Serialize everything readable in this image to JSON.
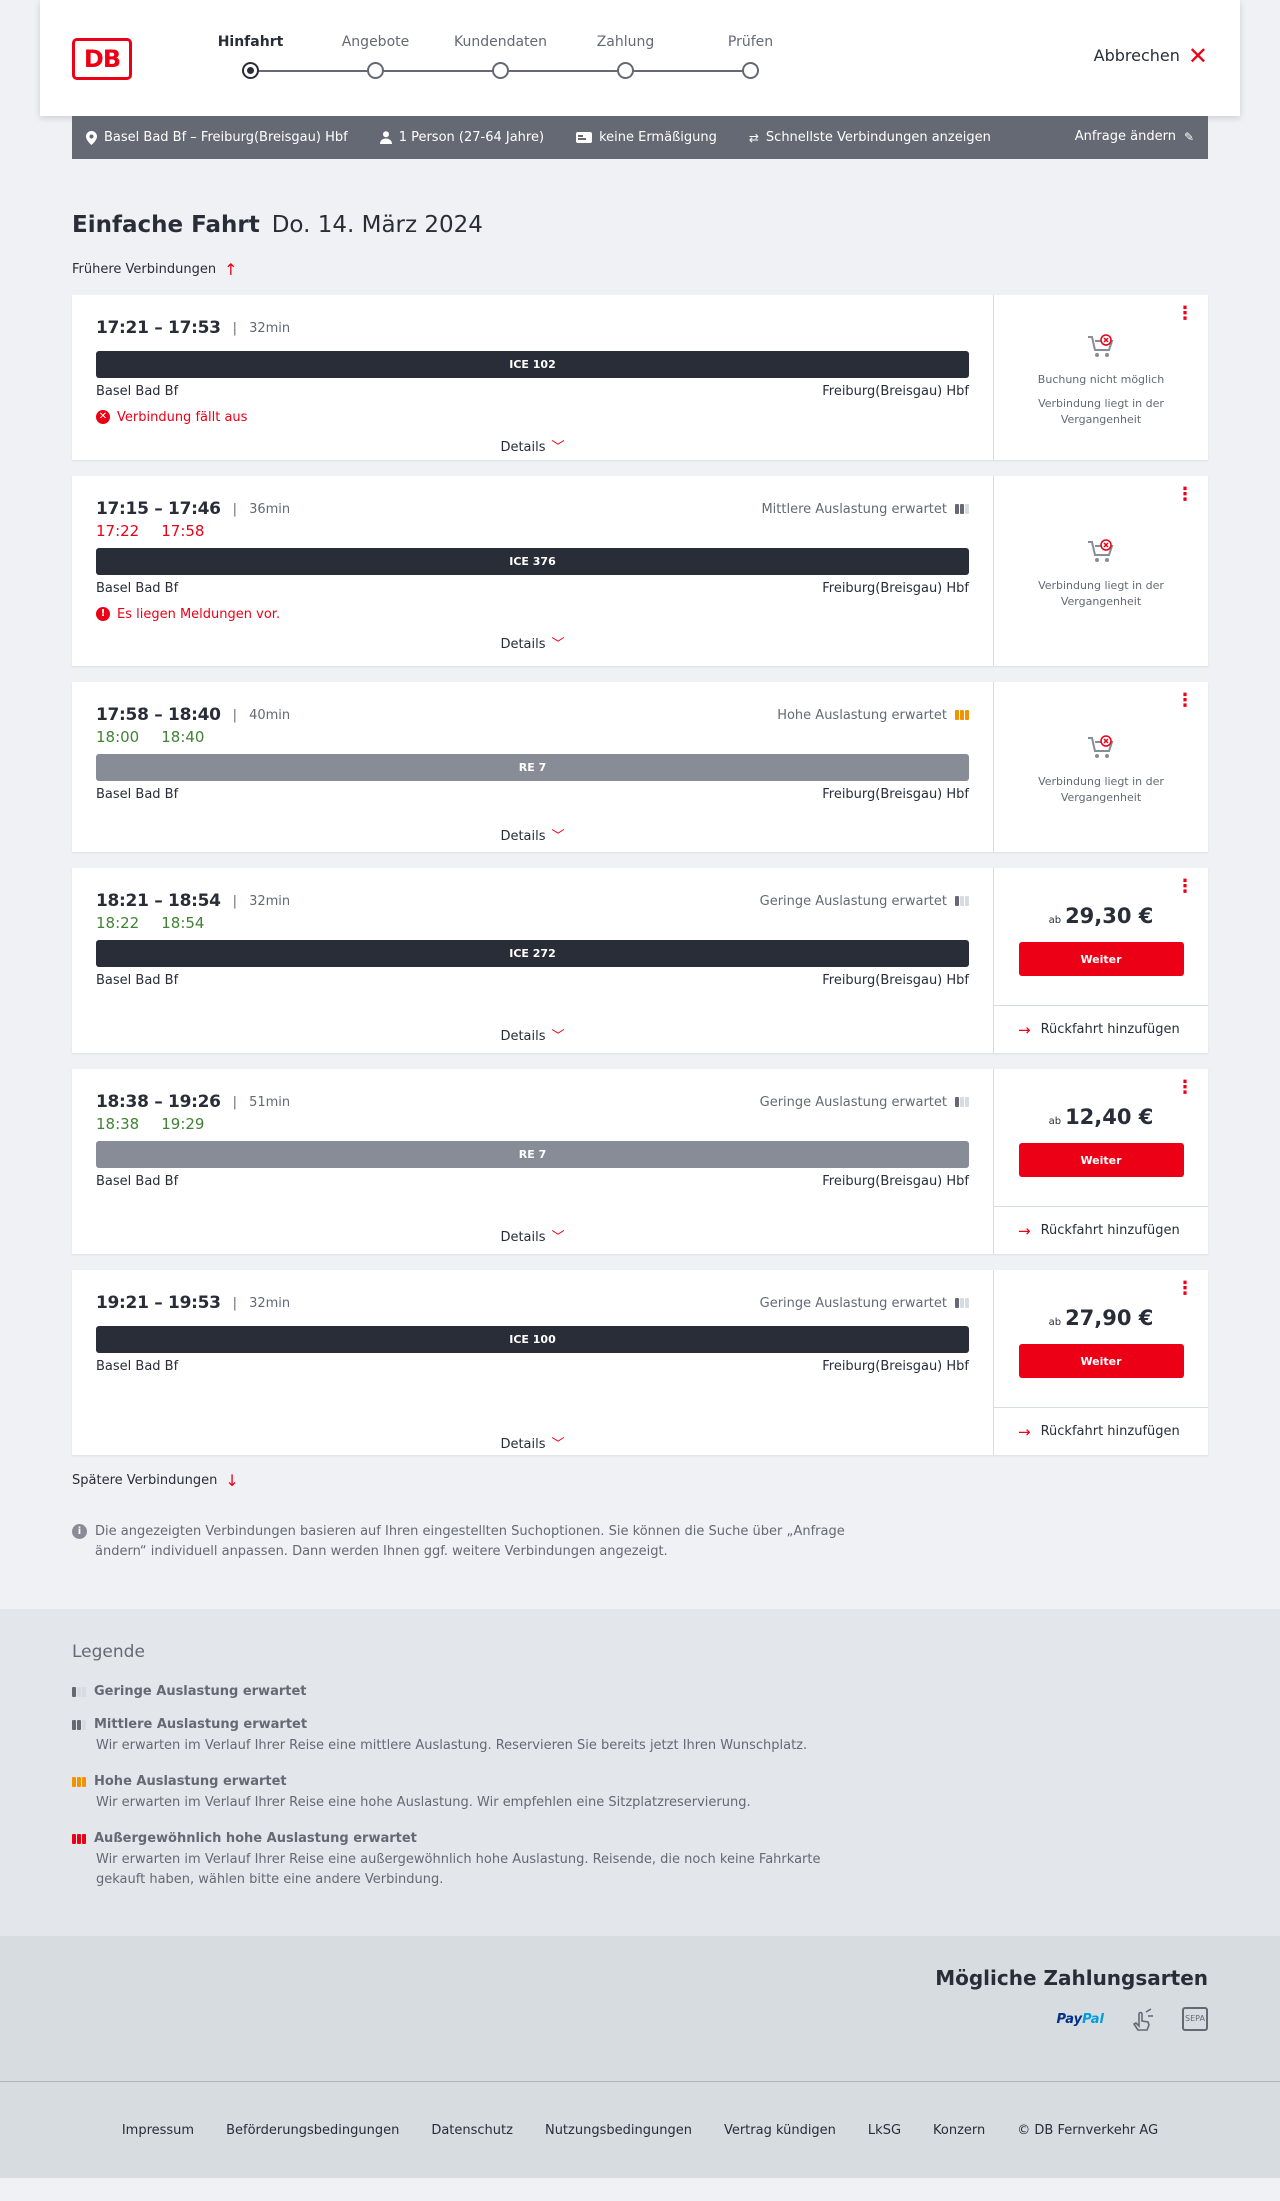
{
  "header": {
    "logo_text": "DB",
    "steps": [
      {
        "label": "Hinfahrt",
        "active": true
      },
      {
        "label": "Angebote",
        "active": false
      },
      {
        "label": "Kundendaten",
        "active": false
      },
      {
        "label": "Zahlung",
        "active": false
      },
      {
        "label": "Prüfen",
        "active": false
      }
    ],
    "cancel_label": "Abbrechen"
  },
  "summary": {
    "route": "Basel Bad Bf – Freiburg(Breisgau) Hbf",
    "persons": "1 Person (27-64 Jahre)",
    "discount": "keine Ermäßigung",
    "fastest": "Schnellste Verbindungen anzeigen",
    "edit_label": "Anfrage ändern"
  },
  "page": {
    "title": "Einfache Fahrt",
    "date": "Do. 14. März 2024",
    "earlier": "Frühere Verbindungen",
    "later": "Spätere Verbindungen",
    "info": "Die angezeigten Verbindungen basieren auf Ihren eingestellten Suchoptionen. Sie können die Suche über „Anfrage ändern“ individuell anpassen. Dann werden Ihnen ggf. weitere Verbindungen angezeigt."
  },
  "connections": [
    {
      "times": "17:21 – 17:53",
      "duration": "32min",
      "load": "",
      "real_dep": "",
      "real_arr": "",
      "train": "ICE 102",
      "from": "Basel Bad Bf",
      "to": "Freiburg(Breisgau) Hbf",
      "message": "Verbindung fällt aus",
      "details": "Details",
      "status_1": "Buchung nicht möglich",
      "status_2": "Verbindung liegt in der Vergangenheit"
    },
    {
      "times": "17:15 – 17:46",
      "duration": "36min",
      "load": "Mittlere Auslastung erwartet",
      "real_dep": "17:22",
      "real_arr": "17:58",
      "train": "ICE 376",
      "from": "Basel Bad Bf",
      "to": "Freiburg(Breisgau) Hbf",
      "message": "Es liegen Meldungen vor.",
      "details": "Details",
      "status_2": "Verbindung liegt in der Vergangenheit"
    },
    {
      "times": "17:58 – 18:40",
      "duration": "40min",
      "load": "Hohe Auslastung erwartet",
      "real_dep": "18:00",
      "real_arr": "18:40",
      "train": "RE 7",
      "from": "Basel Bad Bf",
      "to": "Freiburg(Breisgau) Hbf",
      "details": "Details",
      "status_2": "Verbindung liegt in der Vergangenheit"
    },
    {
      "times": "18:21 – 18:54",
      "duration": "32min",
      "load": "Geringe Auslastung erwartet",
      "real_dep": "18:22",
      "real_arr": "18:54",
      "train": "ICE 272",
      "from": "Basel Bad Bf",
      "to": "Freiburg(Breisgau) Hbf",
      "details": "Details",
      "price_prefix": "ab",
      "price": "29,30 €",
      "button": "Weiter",
      "return": "Rückfahrt hinzufügen"
    },
    {
      "times": "18:38 – 19:26",
      "duration": "51min",
      "load": "Geringe Auslastung erwartet",
      "real_dep": "18:38",
      "real_arr": "19:29",
      "train": "RE 7",
      "from": "Basel Bad Bf",
      "to": "Freiburg(Breisgau) Hbf",
      "details": "Details",
      "price_prefix": "ab",
      "price": "12,40 €",
      "button": "Weiter",
      "return": "Rückfahrt hinzufügen"
    },
    {
      "times": "19:21 – 19:53",
      "duration": "32min",
      "load": "Geringe Auslastung erwartet",
      "train": "ICE 100",
      "from": "Basel Bad Bf",
      "to": "Freiburg(Breisgau) Hbf",
      "details": "Details",
      "price_prefix": "ab",
      "price": "27,90 €",
      "button": "Weiter",
      "return": "Rückfahrt hinzufügen"
    }
  ],
  "legend": {
    "title": "Legende",
    "items": [
      {
        "title": "Geringe Auslastung erwartet",
        "desc": ""
      },
      {
        "title": "Mittlere Auslastung erwartet",
        "desc": "Wir erwarten im Verlauf Ihrer Reise eine mittlere Auslastung. Reservieren Sie bereits jetzt Ihren Wunschplatz."
      },
      {
        "title": "Hohe Auslastung erwartet",
        "desc": "Wir erwarten im Verlauf Ihrer Reise eine hohe Auslastung. Wir empfehlen eine Sitzplatzreservierung."
      },
      {
        "title": "Außergewöhnlich hohe Auslastung erwartet",
        "desc": "Wir erwarten im Verlauf Ihrer Reise eine außergewöhnlich hohe Auslastung. Reisende, die noch keine Fahrkarte gekauft haben, wählen bitte eine andere Verbindung."
      }
    ]
  },
  "payment": {
    "title": "Mögliche Zahlungsarten",
    "paypal_1": "Pay",
    "paypal_2": "Pal",
    "sepa": "SEPA"
  },
  "footer": {
    "links": [
      "Impressum",
      "Beförderungsbedingungen",
      "Datenschutz",
      "Nutzungsbedingungen",
      "Vertrag kündigen",
      "LkSG",
      "Konzern",
      "© DB Fernverkehr AG"
    ]
  },
  "colors": {
    "brand_red": "#ec0016",
    "dark": "#282d37",
    "grey": "#646973",
    "green": "#408335",
    "orange": "#f39200"
  },
  "icons": {
    "location": "location-pin-icon",
    "person": "person-icon",
    "bahncard": "card-icon",
    "swap": "swap-icon",
    "pencil": "pencil-icon",
    "close": "close-icon",
    "arrow": "arrow-icon",
    "chevron": "chevron-down-icon",
    "cart": "cart-disabled-icon",
    "load": "load-level-icon"
  }
}
